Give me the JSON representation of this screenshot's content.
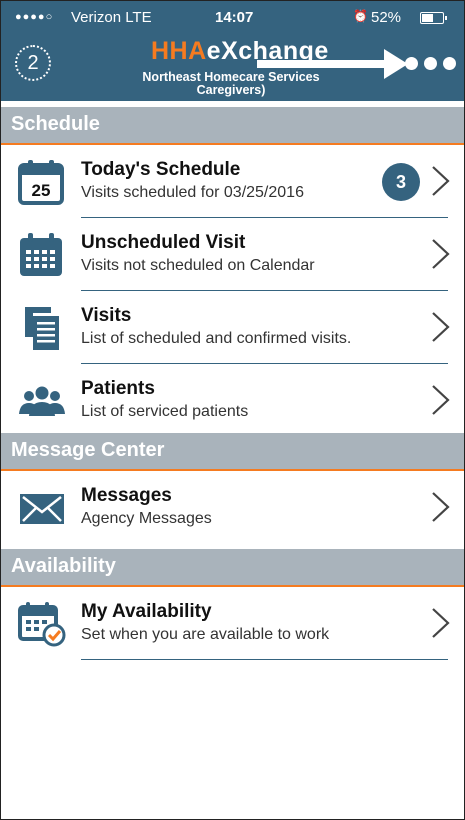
{
  "status_bar": {
    "signal": "●●●●○",
    "carrier": "Verizon  LTE",
    "time": "14:07",
    "battery": "52%"
  },
  "header": {
    "message_count": "2",
    "brand_part1": "HHA",
    "brand_part2": "eXchange",
    "organization_line1": "Northeast Homecare Services",
    "organization_line2": "Caregivers)"
  },
  "sections": {
    "schedule": "Schedule",
    "message_center": "Message Center",
    "availability": "Availability"
  },
  "items": {
    "todays_schedule": {
      "title": "Today's Schedule",
      "subtitle": "Visits scheduled for 03/25/2016",
      "count": "3",
      "calendar_day": "25"
    },
    "unscheduled_visit": {
      "title": "Unscheduled Visit",
      "subtitle": "Visits not scheduled on Calendar"
    },
    "visits": {
      "title": "Visits",
      "subtitle": "List of scheduled and confirmed visits."
    },
    "patients": {
      "title": "Patients",
      "subtitle": "List of serviced patients"
    },
    "messages": {
      "title": "Messages",
      "subtitle": "Agency Messages"
    },
    "my_availability": {
      "title": "My Availability",
      "subtitle": "Set when you are available to work"
    }
  },
  "colors": {
    "header_bg": "#35637f",
    "accent_orange": "#f57b20",
    "section_bg": "#a9b3bb",
    "icon_blue": "#35637f"
  },
  "icons": {
    "messages_badge": "speech-bubble-icon",
    "more": "more-dots-icon",
    "chevron": "chevron-right-icon"
  }
}
